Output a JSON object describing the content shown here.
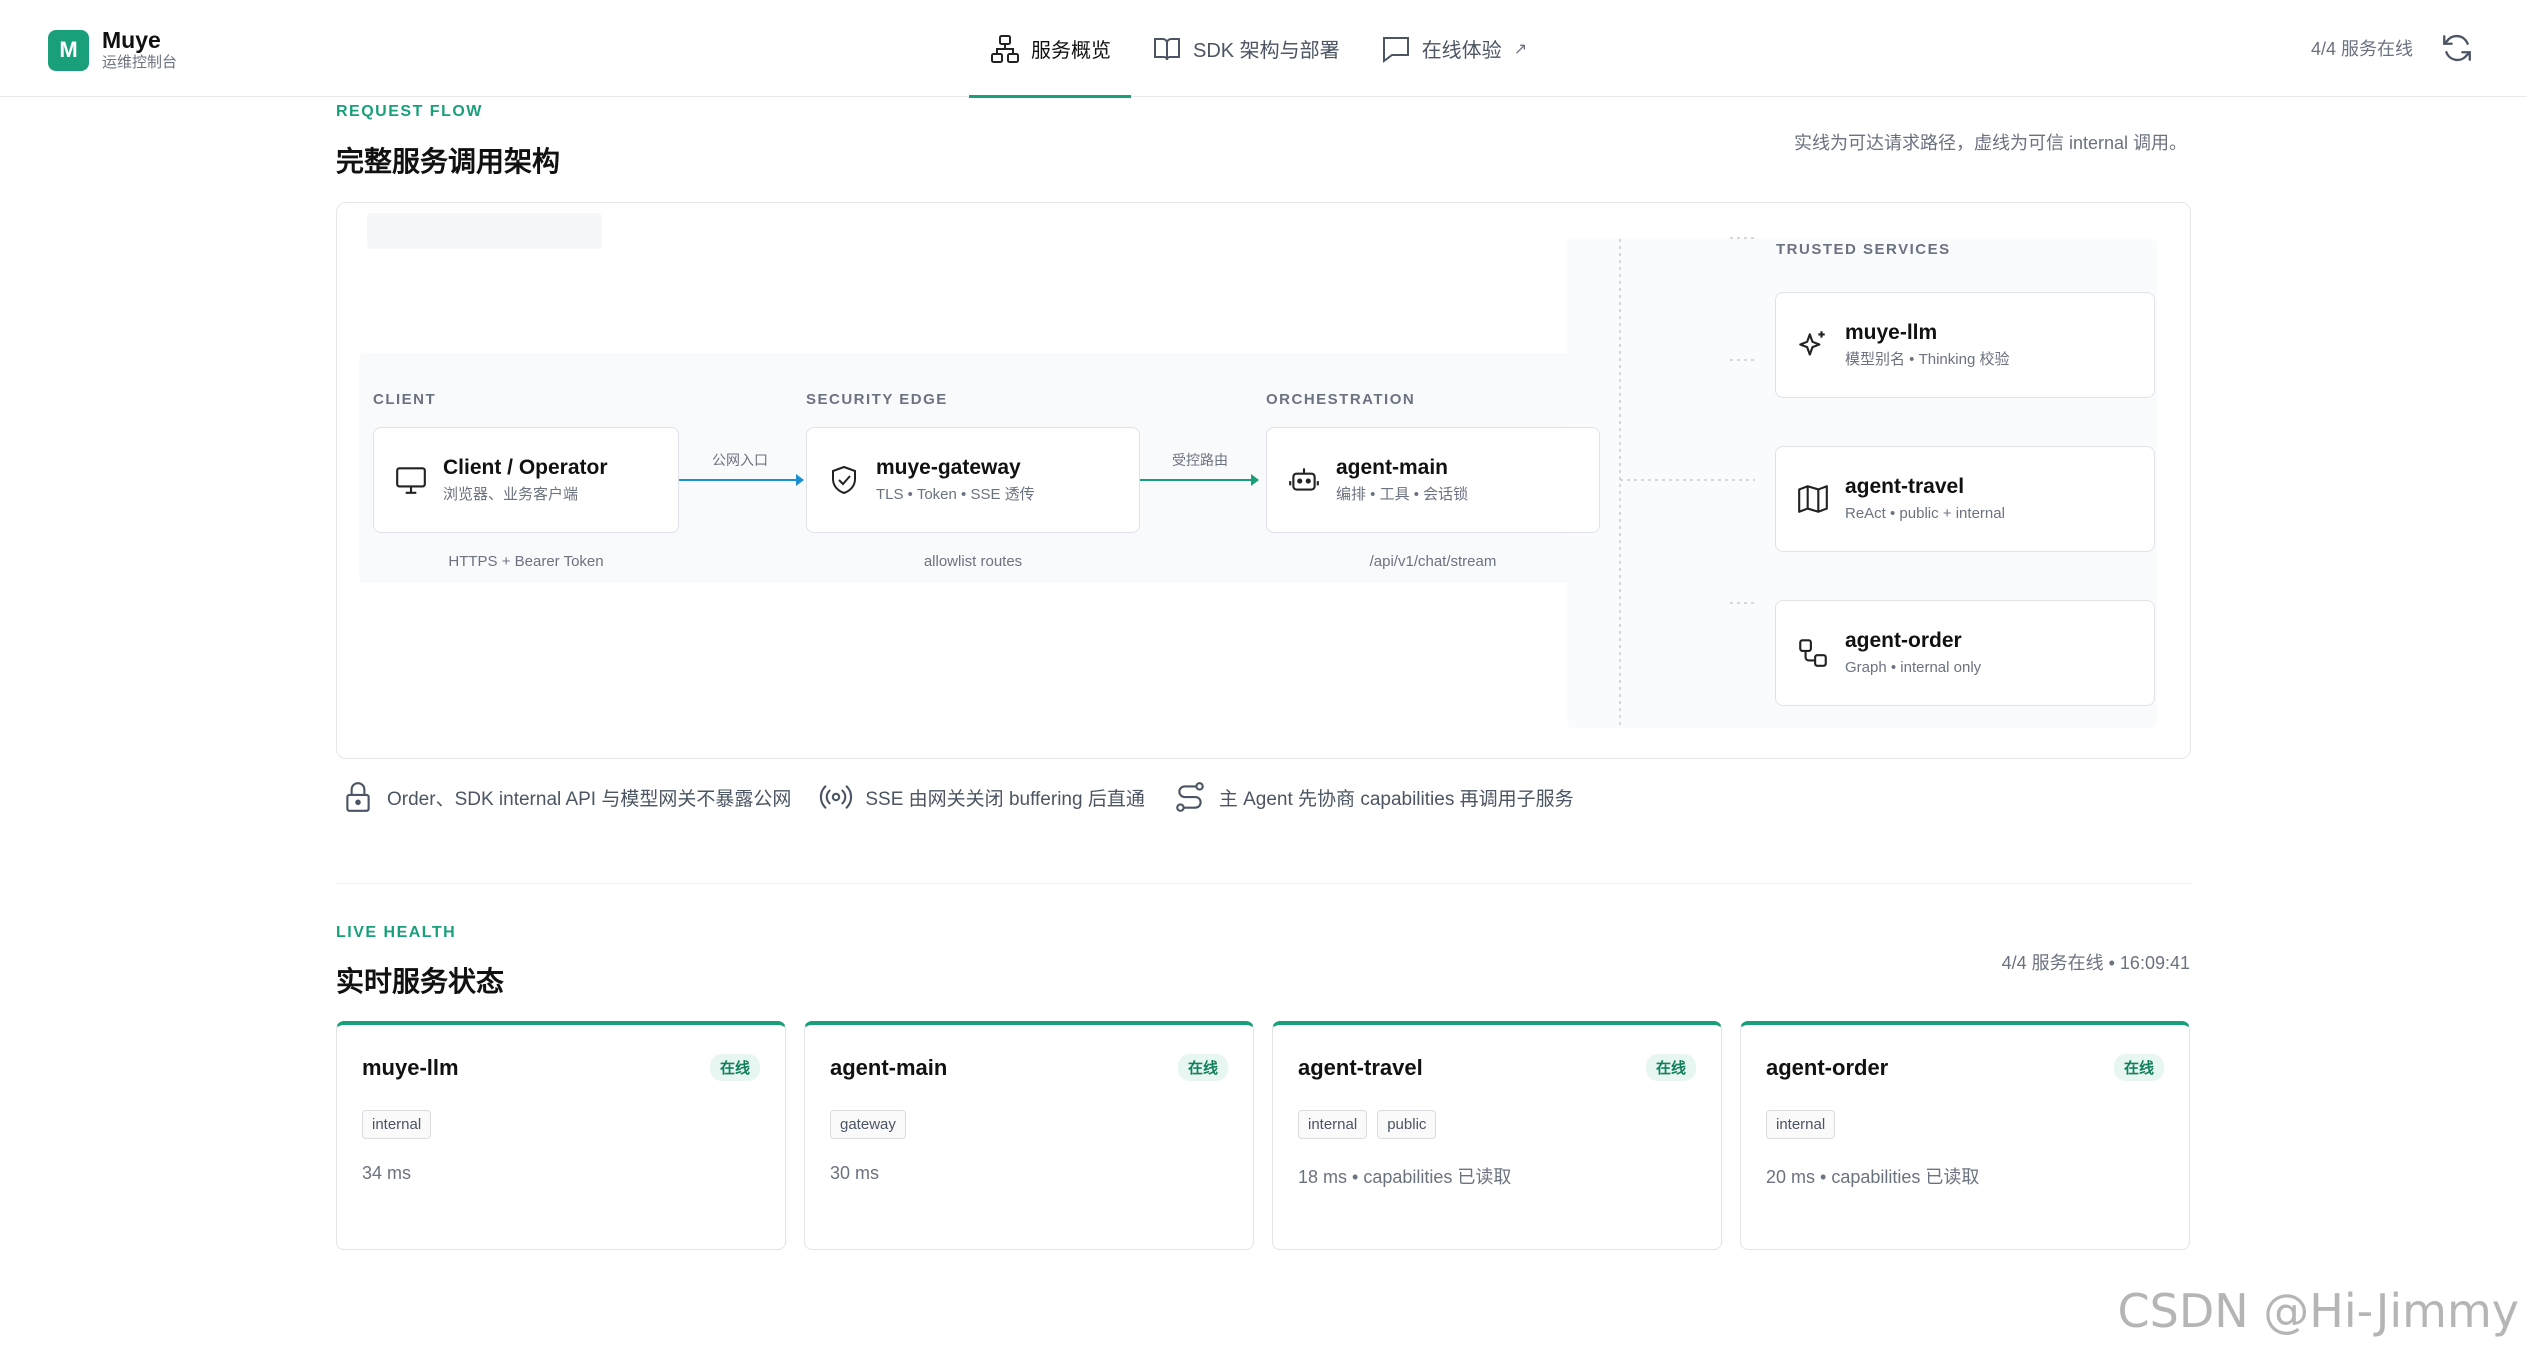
{
  "brand": {
    "logo_letter": "M",
    "name": "Muye",
    "subtitle": "运维控制台"
  },
  "nav": {
    "items": [
      {
        "label": "服务概览",
        "icon": "network-icon",
        "active": true
      },
      {
        "label": "SDK 架构与部署",
        "icon": "book-icon",
        "active": false
      },
      {
        "label": "在线体验",
        "icon": "chat-icon",
        "active": false,
        "external": "↗"
      }
    ]
  },
  "header": {
    "online_count": "4/4 服务在线"
  },
  "request_flow": {
    "eyebrow": "REQUEST FLOW",
    "title": "完整服务调用架构",
    "note": "实线为可达请求路径，虚线为可信 internal 调用。",
    "columns": {
      "client": "CLIENT",
      "security": "SECURITY EDGE",
      "orchestration": "ORCHESTRATION",
      "trusted": "TRUSTED SERVICES"
    },
    "nodes": {
      "client": {
        "title": "Client / Operator",
        "sub": "浏览器、业务客户端",
        "caption": "HTTPS + Bearer Token"
      },
      "gateway": {
        "title": "muye-gateway",
        "sub": "TLS  •  Token  •  SSE 透传",
        "caption": "allowlist routes"
      },
      "agent_main": {
        "title": "agent-main",
        "sub": "编排  •  工具  •  会话锁",
        "caption": "/api/v1/chat/stream"
      },
      "llm": {
        "title": "muye-llm",
        "sub": "模型别名  •  Thinking 校验"
      },
      "travel": {
        "title": "agent-travel",
        "sub": "ReAct  •  public + internal"
      },
      "order": {
        "title": "agent-order",
        "sub": "Graph  •  internal only"
      }
    },
    "edges": {
      "client_gateway": "公网入口",
      "gateway_main": "受控路由"
    },
    "footnotes": [
      {
        "icon": "lock-icon",
        "text": "Order、SDK internal API 与模型网关不暴露公网"
      },
      {
        "icon": "broadcast-icon",
        "text": "SSE 由网关关闭 buffering 后直通"
      },
      {
        "icon": "route-icon",
        "text": "主 Agent 先协商 capabilities 再调用子服务"
      }
    ]
  },
  "live_health": {
    "eyebrow": "LIVE HEALTH",
    "title": "实时服务状态",
    "summary": "4/4 服务在线  •  16:09:41",
    "cards": [
      {
        "name": "muye-llm",
        "status": "在线",
        "tags": [
          "internal"
        ],
        "meta": "34 ms"
      },
      {
        "name": "agent-main",
        "status": "在线",
        "tags": [
          "gateway"
        ],
        "meta": "30 ms"
      },
      {
        "name": "agent-travel",
        "status": "在线",
        "tags": [
          "internal",
          "public"
        ],
        "meta": "18 ms  •  capabilities 已读取"
      },
      {
        "name": "agent-order",
        "status": "在线",
        "tags": [
          "internal"
        ],
        "meta": "20 ms  •  capabilities 已读取"
      }
    ]
  },
  "watermark": "CSDN @Hi-Jimmy",
  "colors": {
    "accent": "#19a07a",
    "edge": "#1a8fd1",
    "status_bg": "#e7f6f0"
  }
}
